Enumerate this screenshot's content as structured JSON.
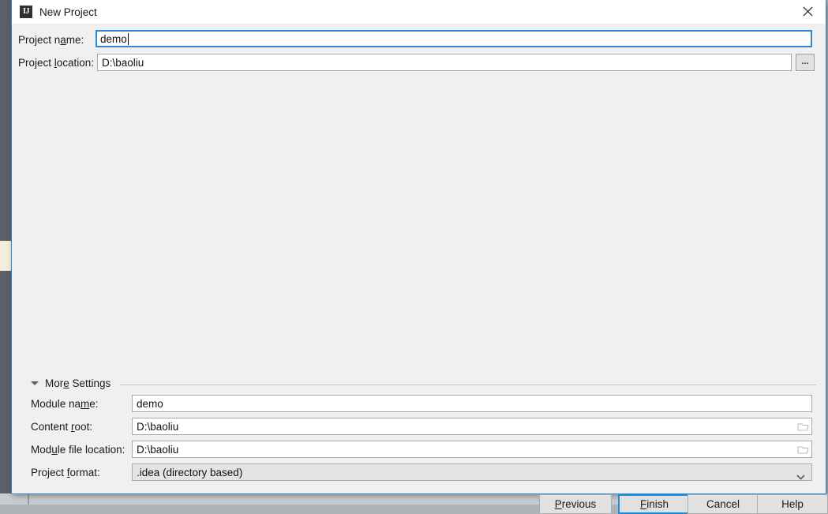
{
  "window": {
    "title": "New Project",
    "icon": "idea-app-icon",
    "close_label": "✕",
    "border_color": "#2e8ad6"
  },
  "fields": {
    "project_name": {
      "label_pre": "Project n",
      "label_mnemonic": "a",
      "label_post": "me:",
      "value": "demo",
      "focused": true
    },
    "project_location": {
      "label_pre": "Project ",
      "label_mnemonic": "l",
      "label_post": "ocation:",
      "value": "D:\\baoliu",
      "browse_button": "..."
    }
  },
  "more_settings": {
    "label_pre": "Mor",
    "label_mnemonic": "e",
    "label_post": " Settings",
    "expanded": true,
    "rows": [
      {
        "label_pre": "Module na",
        "label_mnemonic": "m",
        "label_post": "e:",
        "value": "demo",
        "has_folder_icon": false
      },
      {
        "label_pre": "Content ",
        "label_mnemonic": "r",
        "label_post": "oot:",
        "value": "D:\\baoliu",
        "has_folder_icon": true
      },
      {
        "label_pre": "Mod",
        "label_mnemonic": "u",
        "label_post": "le file location:",
        "value": "D:\\baoliu",
        "has_folder_icon": true
      }
    ],
    "project_format": {
      "label_pre": "Project ",
      "label_mnemonic": "f",
      "label_post": "ormat:",
      "value": ".idea (directory based)"
    }
  },
  "buttons": [
    {
      "name": "previous",
      "label_pre": "",
      "label_mnemonic": "P",
      "label_post": "revious",
      "default": false
    },
    {
      "name": "finish",
      "label_pre": "",
      "label_mnemonic": "F",
      "label_post": "inish",
      "default": true
    },
    {
      "name": "cancel",
      "label_pre": "Cancel",
      "label_mnemonic": "",
      "label_post": "",
      "default": false
    },
    {
      "name": "help",
      "label_pre": "Help",
      "label_mnemonic": "",
      "label_post": "",
      "default": false
    }
  ]
}
